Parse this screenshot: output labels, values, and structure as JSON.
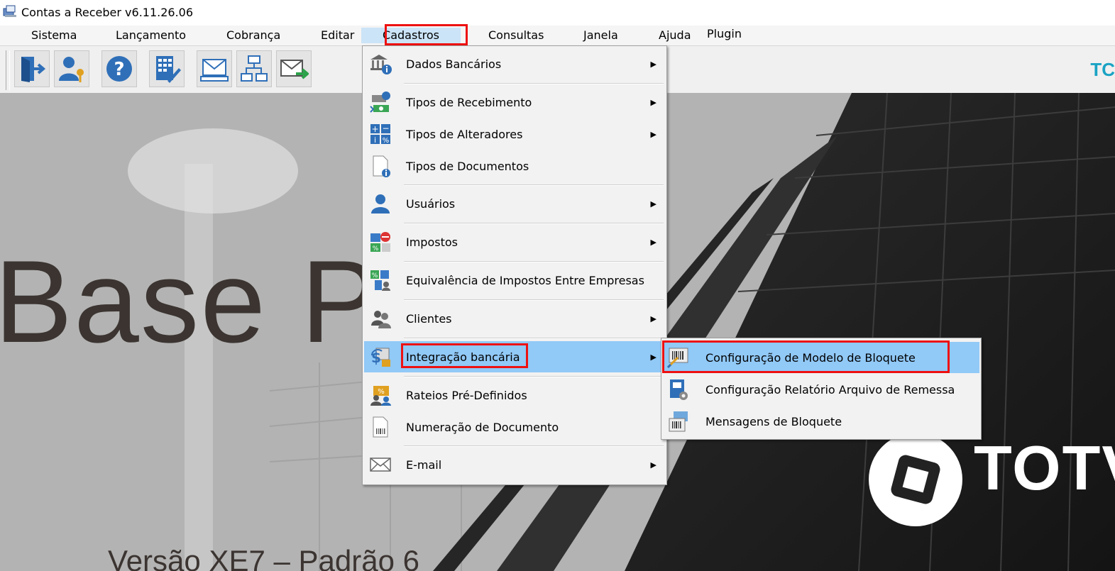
{
  "window": {
    "title": "Contas a Receber v6.11.26.06"
  },
  "menubar": [
    {
      "label": "Sistema"
    },
    {
      "label": "Lançamento"
    },
    {
      "label": "Cobrança"
    },
    {
      "label": "Editar"
    },
    {
      "label": "Cadastros"
    },
    {
      "label": "Consultas"
    },
    {
      "label": "Janela"
    },
    {
      "label": "Ajuda"
    },
    {
      "label": "Plugin"
    }
  ],
  "toolbar": {
    "buttons": [
      {
        "icon": "exit-door-icon"
      },
      {
        "icon": "user-key-icon"
      },
      {
        "icon": "help-icon"
      },
      {
        "icon": "calculator-edit-icon"
      },
      {
        "icon": "mail-print-icon"
      },
      {
        "icon": "org-chart-icon"
      },
      {
        "icon": "mail-send-icon"
      }
    ],
    "brand": "TC"
  },
  "cadastros_menu": [
    {
      "label": "Dados Bancários",
      "submenu": true,
      "icon": "bank-info-icon"
    },
    {
      "label": "Tipos de Recebimento",
      "submenu": true,
      "icon": "money-receive-icon"
    },
    {
      "label": "Tipos de Alteradores",
      "submenu": true,
      "icon": "calc-percent-icon"
    },
    {
      "label": "Tipos de Documentos",
      "submenu": false,
      "icon": "document-info-icon"
    },
    {
      "label": "Usuários",
      "submenu": true,
      "icon": "user-icon"
    },
    {
      "label": "Impostos",
      "submenu": true,
      "icon": "tax-icon"
    },
    {
      "label": "Equivalência de Impostos Entre Empresas",
      "submenu": false,
      "icon": "tax-equivalence-icon"
    },
    {
      "label": "Clientes",
      "submenu": true,
      "icon": "clients-icon"
    },
    {
      "label": "Integração bancária",
      "submenu": true,
      "icon": "bank-integration-icon",
      "highlighted": true
    },
    {
      "label": "Rateios Pré-Definidos",
      "submenu": false,
      "icon": "apportionment-icon"
    },
    {
      "label": "Numeração de Documento",
      "submenu": false,
      "icon": "document-barcode-icon"
    },
    {
      "label": "E-mail",
      "submenu": true,
      "icon": "email-icon"
    }
  ],
  "integracao_submenu": [
    {
      "label": "Configuração de Modelo de Bloquete",
      "icon": "barcode-config-icon",
      "highlighted": true
    },
    {
      "label": "Configuração Relatório Arquivo de Remessa",
      "icon": "report-gear-icon"
    },
    {
      "label": "Mensagens de Bloquete",
      "icon": "message-barcode-icon"
    }
  ],
  "background": {
    "big_text": "Base P",
    "version": "Versão XE7 – Padrão 6",
    "brand": "TOTV"
  },
  "colors": {
    "highlight": "#91c9f7",
    "menu_active": "#cce4f7",
    "annotation": "#e11111",
    "brand": "#1aa3c4"
  }
}
